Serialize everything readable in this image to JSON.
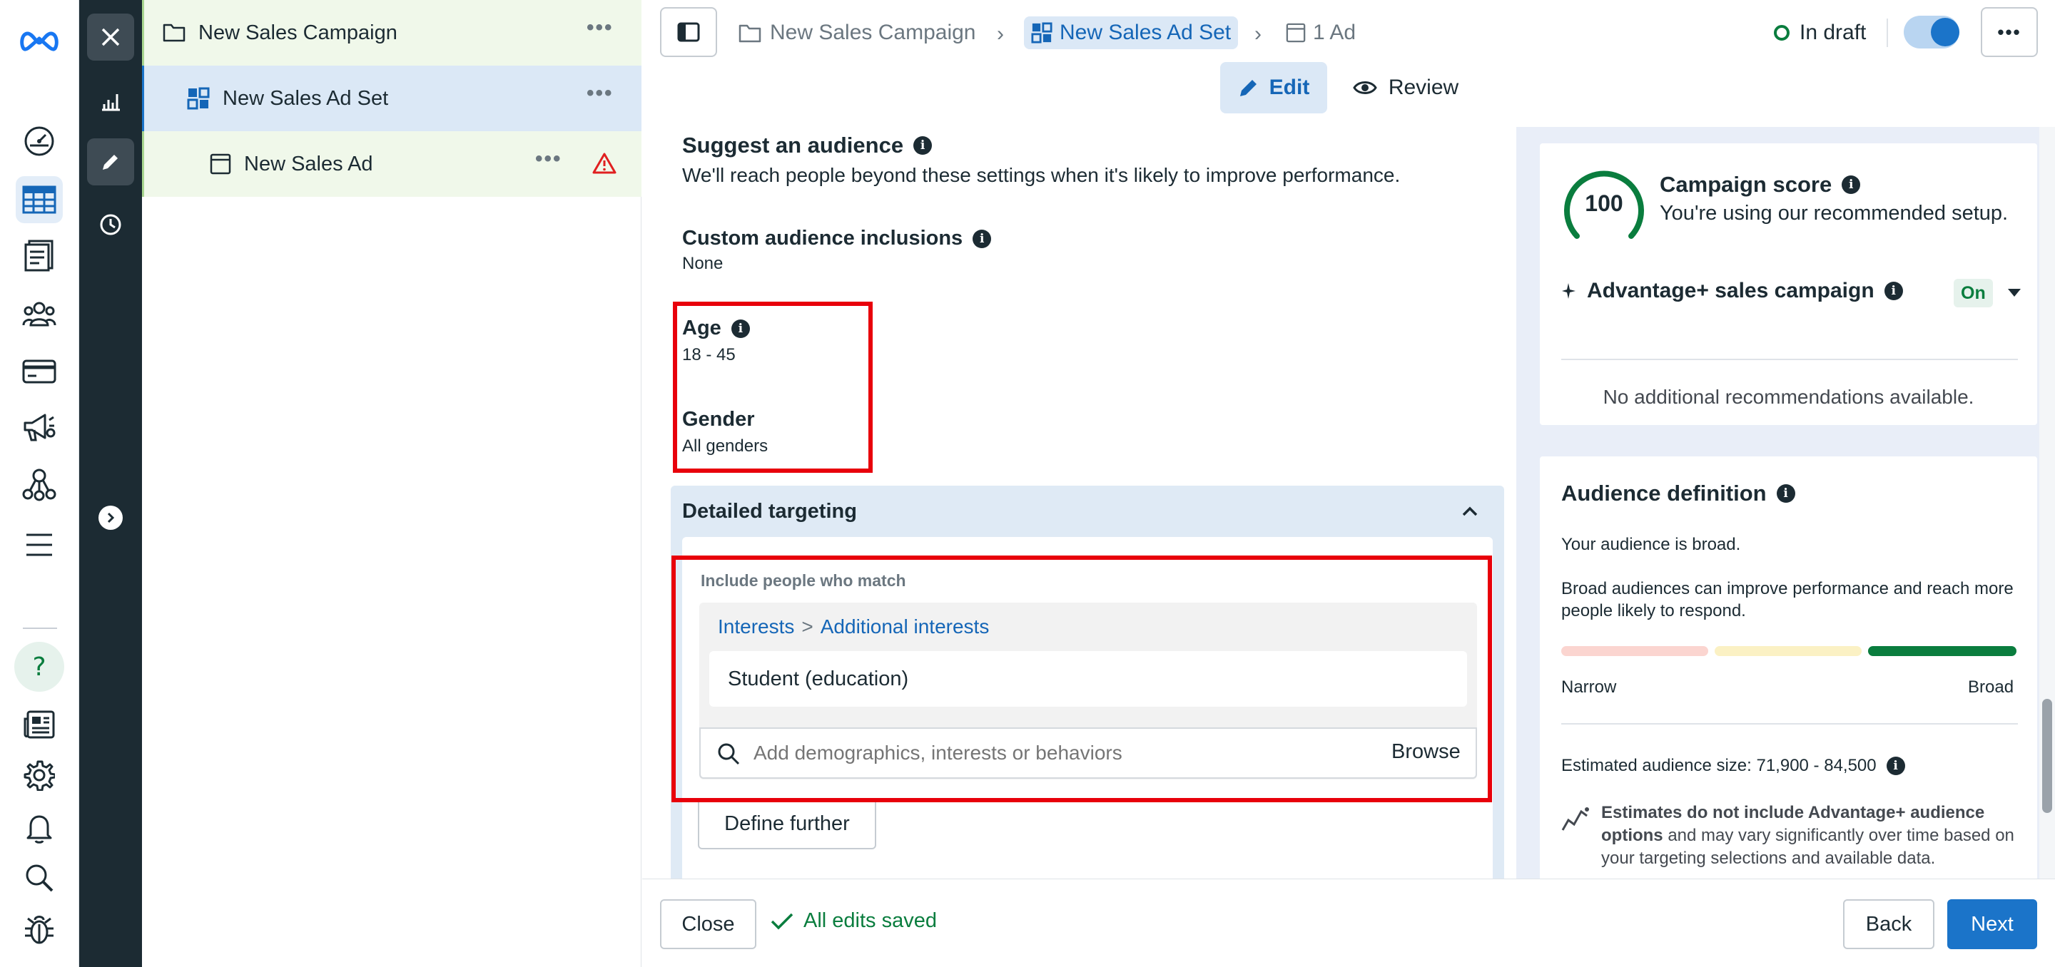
{
  "nav_rail": {
    "items": [
      {
        "icon": "meta-logo-icon"
      },
      {
        "icon": "gauge-icon"
      },
      {
        "icon": "table-grid-icon",
        "active": true
      },
      {
        "icon": "catalog-icon"
      },
      {
        "icon": "people-icon"
      },
      {
        "icon": "credit-card-icon"
      },
      {
        "icon": "megaphone-icon"
      },
      {
        "icon": "network-icon"
      },
      {
        "icon": "menu-icon"
      },
      {
        "icon": "help-icon"
      },
      {
        "icon": "newspaper-icon"
      },
      {
        "icon": "gear-icon"
      },
      {
        "icon": "bell-icon"
      },
      {
        "icon": "search-icon"
      },
      {
        "icon": "bug-icon"
      }
    ],
    "help_glyph": "?"
  },
  "tree": {
    "campaign": "New Sales Campaign",
    "ad_set": "New Sales Ad Set",
    "ad": "New Sales Ad"
  },
  "header": {
    "breadcrumbs": [
      "New Sales Campaign",
      "New Sales Ad Set",
      "1 Ad"
    ],
    "status": "In draft",
    "toggle_on": true,
    "tabs": {
      "edit": "Edit",
      "review": "Review"
    }
  },
  "form": {
    "suggest_title": "Suggest an audience",
    "suggest_desc": "We'll reach people beyond these settings when it's likely to improve performance.",
    "custom_audience_label": "Custom audience inclusions",
    "custom_audience_value": "None",
    "age_label": "Age",
    "age_value": "18 - 45",
    "gender_label": "Gender",
    "gender_value": "All genders",
    "detailed_targeting_label": "Detailed targeting",
    "include_label": "Include people who match",
    "interest_path": {
      "root": "Interests",
      "separator": ">",
      "leaf": "Additional interests"
    },
    "interest_chip": "Student (education)",
    "search_placeholder": "Add demographics, interests or behaviors",
    "browse_label": "Browse",
    "define_further_label": "Define further"
  },
  "score_card": {
    "score": "100",
    "title": "Campaign score",
    "subtitle": "You're using our recommended setup.",
    "advantage_label": "Advantage+ sales campaign",
    "advantage_status": "On",
    "no_recs": "No additional recommendations available."
  },
  "audience_card": {
    "title": "Audience definition",
    "line1": "Your audience is broad.",
    "line2": "Broad audiences can improve performance and reach more people likely to respond.",
    "meter_level": "Broad",
    "narrow_label": "Narrow",
    "broad_label": "Broad",
    "estimate": "Estimated audience size: 71,900 - 84,500",
    "note_bold": "Estimates do not include Advantage+ audience options",
    "note_rest": " and may vary significantly over time based on your targeting selections and available data."
  },
  "footer": {
    "close_label": "Close",
    "saved_label": "All edits saved",
    "back_label": "Back",
    "next_label": "Next"
  },
  "colors": {
    "primary_blue": "#1b74c9",
    "link_blue": "#1566b7",
    "success_green": "#0a7d3e",
    "warning_red": "#e02020",
    "highlight_red": "#e8000b",
    "dark_strip": "#1c2b33"
  }
}
